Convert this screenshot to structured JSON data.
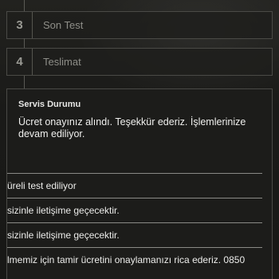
{
  "steps": [
    {
      "number": "3",
      "label": "Son Test"
    },
    {
      "number": "4",
      "label": "Teslimat"
    }
  ],
  "status_panel": {
    "title": "Servis Durumu",
    "message": "Ücret onayınız alındı. Teşekkür ederiz. İşlemlerinize devam ediliyor.",
    "log_entries": [
      "üreli test ediliyor",
      "sizinle iletişime geçecektir.",
      "sizinle iletişime geçecektir.",
      "lmemiz için tamir ücretini onaylamanızı rica ederiz. 0850"
    ]
  }
}
